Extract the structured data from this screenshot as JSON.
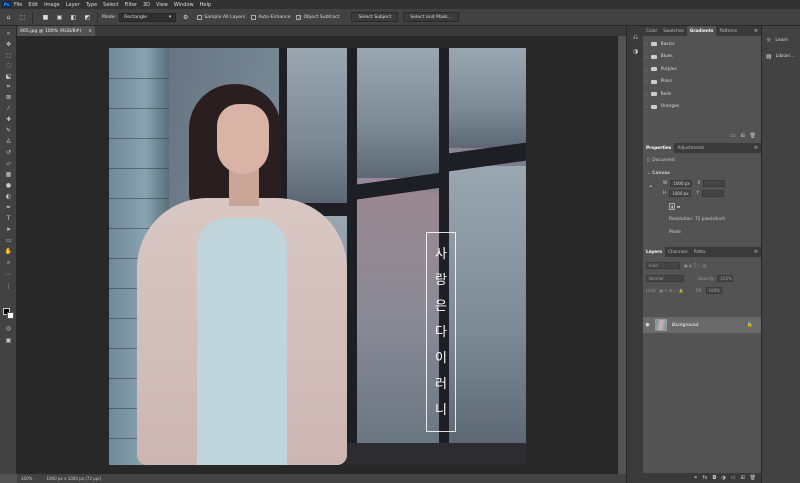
{
  "menubar": {
    "logo": "Ps",
    "items": [
      "File",
      "Edit",
      "Image",
      "Layer",
      "Type",
      "Select",
      "Filter",
      "3D",
      "View",
      "Window",
      "Help"
    ]
  },
  "options": {
    "mode_label": "Mode:",
    "mode_value": "Rectangle",
    "sample_all_layers": "Sample All Layers",
    "auto_enhance": "Auto-Enhance",
    "object_subtract": "Object Subtract",
    "object_subtract_checked": "✓",
    "select_subject": "Select Subject",
    "select_and_mask": "Select and Mask..."
  },
  "document": {
    "tab_title": "005.jpg @ 100% (RGB/8#)",
    "close": "×",
    "artwork_text": [
      "사",
      "랑",
      "은",
      "다",
      "이",
      "러",
      "니"
    ]
  },
  "status": {
    "zoom": "100%",
    "doc_info": "1000 px x 1000 px (72 ppi)"
  },
  "panel_tabs": {
    "top": [
      "Color",
      "Swatches",
      "Gradients",
      "Patterns"
    ],
    "top_active": "Gradients",
    "props": [
      "Properties",
      "Adjustments"
    ],
    "props_active": "Properties",
    "layers": [
      "Layers",
      "Channels",
      "Paths"
    ],
    "layers_active": "Layers",
    "menu": "≡"
  },
  "gradients": [
    "Basics",
    "Blues",
    "Purples",
    "Pinks",
    "Reds",
    "Oranges"
  ],
  "properties": {
    "doc_label": "Document",
    "canvas_label": "Canvas",
    "w_label": "W",
    "w_value": "1000 px",
    "h_label": "H",
    "h_value": "1000 px",
    "x_label": "X",
    "y_label": "Y",
    "resolution": "Resolution: 72 pixels/inch",
    "mode": "Mode"
  },
  "layers": {
    "kind": "Kind",
    "blend": "Normal",
    "opacity_label": "Opacity:",
    "opacity": "100%",
    "lock_label": "Lock:",
    "fill_label": "Fill:",
    "fill": "100%",
    "items": [
      {
        "name": "Background"
      }
    ]
  },
  "right_column": [
    {
      "icon": "lightbulb-icon",
      "glyph": "☼",
      "label": "Learn"
    },
    {
      "icon": "libraries-icon",
      "glyph": "▤",
      "label": "Librari..."
    }
  ],
  "colors": {
    "menubar": "#323232",
    "toolbar": "#424242",
    "canvas_bg": "#282828",
    "panel": "#535353",
    "accent": "#31a8ff"
  }
}
